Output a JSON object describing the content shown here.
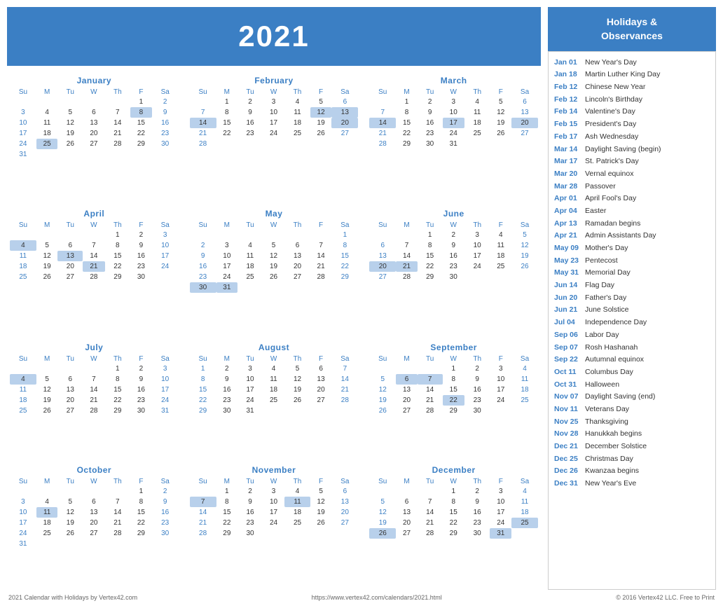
{
  "year": "2021",
  "footer": {
    "left": "2021 Calendar with Holidays by Vertex42.com",
    "center": "https://www.vertex42.com/calendars/2021.html",
    "right": "© 2016 Vertex42 LLC. Free to Print"
  },
  "sidebar": {
    "title": "Holidays &\nObservances",
    "holidays": [
      {
        "date": "Jan 01",
        "name": "New Year's Day"
      },
      {
        "date": "Jan 18",
        "name": "Martin Luther King Day"
      },
      {
        "date": "Feb 12",
        "name": "Chinese New Year"
      },
      {
        "date": "Feb 12",
        "name": "Lincoln's Birthday"
      },
      {
        "date": "Feb 14",
        "name": "Valentine's Day"
      },
      {
        "date": "Feb 15",
        "name": "President's Day"
      },
      {
        "date": "Feb 17",
        "name": "Ash Wednesday"
      },
      {
        "date": "Mar 14",
        "name": "Daylight Saving (begin)"
      },
      {
        "date": "Mar 17",
        "name": "St. Patrick's Day"
      },
      {
        "date": "Mar 20",
        "name": "Vernal equinox"
      },
      {
        "date": "Mar 28",
        "name": "Passover"
      },
      {
        "date": "Apr 01",
        "name": "April Fool's Day"
      },
      {
        "date": "Apr 04",
        "name": "Easter"
      },
      {
        "date": "Apr 13",
        "name": "Ramadan begins"
      },
      {
        "date": "Apr 21",
        "name": "Admin Assistants Day"
      },
      {
        "date": "May 09",
        "name": "Mother's Day"
      },
      {
        "date": "May 23",
        "name": "Pentecost"
      },
      {
        "date": "May 31",
        "name": "Memorial Day"
      },
      {
        "date": "Jun 14",
        "name": "Flag Day"
      },
      {
        "date": "Jun 20",
        "name": "Father's Day"
      },
      {
        "date": "Jun 21",
        "name": "June Solstice"
      },
      {
        "date": "Jul 04",
        "name": "Independence Day"
      },
      {
        "date": "Sep 06",
        "name": "Labor Day"
      },
      {
        "date": "Sep 07",
        "name": "Rosh Hashanah"
      },
      {
        "date": "Sep 22",
        "name": "Autumnal equinox"
      },
      {
        "date": "Oct 11",
        "name": "Columbus Day"
      },
      {
        "date": "Oct 31",
        "name": "Halloween"
      },
      {
        "date": "Nov 07",
        "name": "Daylight Saving (end)"
      },
      {
        "date": "Nov 11",
        "name": "Veterans Day"
      },
      {
        "date": "Nov 25",
        "name": "Thanksgiving"
      },
      {
        "date": "Nov 28",
        "name": "Hanukkah begins"
      },
      {
        "date": "Dec 21",
        "name": "December Solstice"
      },
      {
        "date": "Dec 25",
        "name": "Christmas Day"
      },
      {
        "date": "Dec 26",
        "name": "Kwanzaa begins"
      },
      {
        "date": "Dec 31",
        "name": "New Year's Eve"
      }
    ]
  },
  "months": [
    {
      "name": "January",
      "days": [
        [
          "",
          "",
          "",
          "",
          "",
          "1",
          "2"
        ],
        [
          "3",
          "4",
          "5",
          "6",
          "7",
          "8",
          "9"
        ],
        [
          "10",
          "11",
          "12",
          "13",
          "14",
          "15",
          "16"
        ],
        [
          "17",
          "18",
          "19",
          "20",
          "21",
          "22",
          "23"
        ],
        [
          "24",
          "25",
          "26",
          "27",
          "28",
          "29",
          "30"
        ],
        [
          "31",
          "",
          "",
          "",
          "",
          "",
          ""
        ]
      ],
      "highlights": {
        "1,5": "today",
        "1,6": "weekend",
        "2,6": "weekend",
        "3,0": "weekend",
        "3,6": "weekend",
        "4,0": "weekend",
        "4,6": "weekend",
        "5,0": "weekend",
        "5,6": "weekend",
        "6,0": "weekend",
        "1,1": "highlighted",
        "2,1": "",
        "3,1": ""
      },
      "weekend_cols": [
        0,
        6
      ],
      "blue_cells": [
        [
          1,
          5
        ],
        [
          1,
          6
        ],
        [
          2,
          0
        ],
        [
          2,
          6
        ],
        [
          3,
          0
        ],
        [
          3,
          6
        ],
        [
          4,
          0
        ],
        [
          4,
          6
        ],
        [
          5,
          0
        ],
        [
          5,
          6
        ],
        [
          6,
          0
        ]
      ],
      "special": {
        "r1c5": "today-highlight",
        "r4c1": "highlighted"
      }
    },
    {
      "name": "February",
      "days": [
        [
          "",
          "1",
          "2",
          "3",
          "4",
          "5",
          "6"
        ],
        [
          "7",
          "8",
          "9",
          "10",
          "11",
          "12",
          "13"
        ],
        [
          "14",
          "15",
          "16",
          "17",
          "18",
          "19",
          "20"
        ],
        [
          "21",
          "22",
          "23",
          "24",
          "25",
          "26",
          "27"
        ],
        [
          "28",
          "",
          "",
          "",
          "",
          "",
          ""
        ]
      ],
      "weekend_cols": [
        0,
        6
      ],
      "blue_cells": [
        [
          0,
          6
        ],
        [
          1,
          0
        ],
        [
          1,
          6
        ],
        [
          2,
          0
        ],
        [
          2,
          6
        ],
        [
          3,
          0
        ],
        [
          3,
          6
        ],
        [
          4,
          0
        ]
      ],
      "special": {
        "r1c5": "highlighted",
        "r1c6": "highlighted",
        "r2c0": "highlighted",
        "r2c6": "highlighted"
      }
    },
    {
      "name": "March",
      "days": [
        [
          "",
          "1",
          "2",
          "3",
          "4",
          "5",
          "6"
        ],
        [
          "7",
          "8",
          "9",
          "10",
          "11",
          "12",
          "13"
        ],
        [
          "14",
          "15",
          "16",
          "17",
          "18",
          "19",
          "20"
        ],
        [
          "21",
          "22",
          "23",
          "24",
          "25",
          "26",
          "27"
        ],
        [
          "28",
          "29",
          "30",
          "31",
          "",
          "",
          ""
        ]
      ],
      "weekend_cols": [
        0,
        6
      ],
      "blue_cells": [
        [
          0,
          6
        ],
        [
          1,
          0
        ],
        [
          1,
          6
        ],
        [
          2,
          0
        ],
        [
          2,
          6
        ],
        [
          3,
          0
        ],
        [
          3,
          6
        ],
        [
          4,
          0
        ]
      ],
      "special": {
        "r2c3": "highlighted",
        "r1c6": "highlighted",
        "r2c6": "highlighted"
      }
    },
    {
      "name": "April",
      "days": [
        [
          "",
          "",
          "",
          "",
          "1",
          "2",
          "3"
        ],
        [
          "4",
          "5",
          "6",
          "7",
          "8",
          "9",
          "10"
        ],
        [
          "11",
          "12",
          "13",
          "14",
          "15",
          "16",
          "17"
        ],
        [
          "18",
          "19",
          "20",
          "21",
          "22",
          "23",
          "24"
        ],
        [
          "25",
          "26",
          "27",
          "28",
          "29",
          "30",
          ""
        ]
      ],
      "weekend_cols": [
        0,
        6
      ],
      "blue_cells": [
        [
          0,
          5
        ],
        [
          0,
          6
        ],
        [
          1,
          0
        ],
        [
          1,
          6
        ],
        [
          2,
          0
        ],
        [
          2,
          6
        ],
        [
          3,
          0
        ],
        [
          3,
          6
        ],
        [
          4,
          0
        ]
      ],
      "special": {
        "r1c0": "highlighted",
        "r2c2": "highlighted",
        "r3c3": "highlighted"
      }
    },
    {
      "name": "May",
      "days": [
        [
          "",
          "",
          "",
          "",
          "",
          "",
          "1"
        ],
        [
          "2",
          "3",
          "4",
          "5",
          "6",
          "7",
          "8"
        ],
        [
          "9",
          "10",
          "11",
          "12",
          "13",
          "14",
          "15"
        ],
        [
          "16",
          "17",
          "18",
          "19",
          "20",
          "21",
          "22"
        ],
        [
          "23",
          "24",
          "25",
          "26",
          "27",
          "28",
          "29"
        ],
        [
          "30",
          "31",
          "",
          "",
          "",
          "",
          ""
        ]
      ],
      "weekend_cols": [
        0,
        6
      ],
      "blue_cells": [
        [
          0,
          6
        ],
        [
          1,
          0
        ],
        [
          1,
          6
        ],
        [
          2,
          0
        ],
        [
          2,
          6
        ],
        [
          3,
          0
        ],
        [
          3,
          6
        ],
        [
          4,
          0
        ],
        [
          4,
          6
        ],
        [
          5,
          0
        ]
      ],
      "special": {
        "r5c0": "highlighted",
        "r5c1": "highlighted"
      }
    },
    {
      "name": "June",
      "days": [
        [
          "",
          "",
          "1",
          "2",
          "3",
          "4",
          "5"
        ],
        [
          "6",
          "7",
          "8",
          "9",
          "10",
          "11",
          "12"
        ],
        [
          "13",
          "14",
          "15",
          "16",
          "17",
          "18",
          "19"
        ],
        [
          "20",
          "21",
          "22",
          "23",
          "24",
          "25",
          "26"
        ],
        [
          "27",
          "28",
          "29",
          "30",
          "",
          "",
          ""
        ]
      ],
      "weekend_cols": [
        0,
        6
      ],
      "blue_cells": [
        [
          0,
          5
        ],
        [
          0,
          6
        ],
        [
          1,
          0
        ],
        [
          1,
          6
        ],
        [
          2,
          0
        ],
        [
          2,
          6
        ],
        [
          3,
          0
        ],
        [
          3,
          6
        ],
        [
          4,
          0
        ]
      ],
      "special": {
        "r3c0": "highlighted",
        "r3c1": "highlighted"
      }
    },
    {
      "name": "July",
      "days": [
        [
          "",
          "",
          "",
          "",
          "1",
          "2",
          "3"
        ],
        [
          "4",
          "5",
          "6",
          "7",
          "8",
          "9",
          "10"
        ],
        [
          "11",
          "12",
          "13",
          "14",
          "15",
          "16",
          "17"
        ],
        [
          "18",
          "19",
          "20",
          "21",
          "22",
          "23",
          "24"
        ],
        [
          "25",
          "26",
          "27",
          "28",
          "29",
          "30",
          "31"
        ]
      ],
      "weekend_cols": [
        0,
        6
      ],
      "blue_cells": [
        [
          0,
          5
        ],
        [
          0,
          6
        ],
        [
          1,
          0
        ],
        [
          1,
          6
        ],
        [
          2,
          0
        ],
        [
          2,
          6
        ],
        [
          3,
          0
        ],
        [
          3,
          6
        ],
        [
          4,
          0
        ],
        [
          4,
          6
        ]
      ],
      "special": {
        "r1c0": "highlighted"
      }
    },
    {
      "name": "August",
      "days": [
        [
          "1",
          "2",
          "3",
          "4",
          "5",
          "6",
          "7"
        ],
        [
          "8",
          "9",
          "10",
          "11",
          "12",
          "13",
          "14"
        ],
        [
          "15",
          "16",
          "17",
          "18",
          "19",
          "20",
          "21"
        ],
        [
          "22",
          "23",
          "24",
          "25",
          "26",
          "27",
          "28"
        ],
        [
          "29",
          "30",
          "31",
          "",
          "",
          "",
          ""
        ]
      ],
      "weekend_cols": [
        0,
        6
      ],
      "blue_cells": [
        [
          0,
          0
        ],
        [
          0,
          6
        ],
        [
          1,
          0
        ],
        [
          1,
          6
        ],
        [
          2,
          0
        ],
        [
          2,
          6
        ],
        [
          3,
          0
        ],
        [
          3,
          6
        ],
        [
          4,
          0
        ]
      ],
      "special": {}
    },
    {
      "name": "September",
      "days": [
        [
          "",
          "",
          "",
          "1",
          "2",
          "3",
          "4"
        ],
        [
          "5",
          "6",
          "7",
          "8",
          "9",
          "10",
          "11"
        ],
        [
          "12",
          "13",
          "14",
          "15",
          "16",
          "17",
          "18"
        ],
        [
          "19",
          "20",
          "21",
          "22",
          "23",
          "24",
          "25"
        ],
        [
          "26",
          "27",
          "28",
          "29",
          "30",
          "",
          ""
        ]
      ],
      "weekend_cols": [
        0,
        6
      ],
      "blue_cells": [
        [
          0,
          4
        ],
        [
          0,
          6
        ],
        [
          1,
          0
        ],
        [
          1,
          6
        ],
        [
          2,
          0
        ],
        [
          2,
          6
        ],
        [
          3,
          0
        ],
        [
          3,
          6
        ],
        [
          4,
          0
        ]
      ],
      "special": {
        "r1c1": "highlighted",
        "r1c2": "highlighted",
        "r3c3": "highlighted"
      }
    },
    {
      "name": "October",
      "days": [
        [
          "",
          "",
          "",
          "",
          "",
          "1",
          "2"
        ],
        [
          "3",
          "4",
          "5",
          "6",
          "7",
          "8",
          "9"
        ],
        [
          "10",
          "11",
          "12",
          "13",
          "14",
          "15",
          "16"
        ],
        [
          "17",
          "18",
          "19",
          "20",
          "21",
          "22",
          "23"
        ],
        [
          "24",
          "25",
          "26",
          "27",
          "28",
          "29",
          "30"
        ],
        [
          "31",
          "",
          "",
          "",
          "",
          "",
          ""
        ]
      ],
      "weekend_cols": [
        0,
        6
      ],
      "blue_cells": [
        [
          0,
          6
        ],
        [
          1,
          0
        ],
        [
          1,
          6
        ],
        [
          2,
          0
        ],
        [
          2,
          6
        ],
        [
          3,
          0
        ],
        [
          3,
          6
        ],
        [
          4,
          0
        ],
        [
          4,
          6
        ],
        [
          5,
          0
        ]
      ],
      "special": {
        "r2c1": "highlighted"
      }
    },
    {
      "name": "November",
      "days": [
        [
          "",
          "1",
          "2",
          "3",
          "4",
          "5",
          "6"
        ],
        [
          "7",
          "8",
          "9",
          "10",
          "11",
          "12",
          "13"
        ],
        [
          "14",
          "15",
          "16",
          "17",
          "18",
          "19",
          "20"
        ],
        [
          "21",
          "22",
          "23",
          "24",
          "25",
          "26",
          "27"
        ],
        [
          "28",
          "29",
          "30",
          "",
          "",
          "",
          ""
        ]
      ],
      "weekend_cols": [
        0,
        6
      ],
      "blue_cells": [
        [
          0,
          6
        ],
        [
          1,
          0
        ],
        [
          1,
          6
        ],
        [
          2,
          0
        ],
        [
          2,
          6
        ],
        [
          3,
          0
        ],
        [
          3,
          6
        ],
        [
          4,
          0
        ]
      ],
      "special": {
        "r1c0": "highlighted",
        "r1c6": "highlighted"
      }
    },
    {
      "name": "December",
      "days": [
        [
          "",
          "",
          "",
          "1",
          "2",
          "3",
          "4"
        ],
        [
          "5",
          "6",
          "7",
          "8",
          "9",
          "10",
          "11"
        ],
        [
          "12",
          "13",
          "14",
          "15",
          "16",
          "17",
          "18"
        ],
        [
          "19",
          "20",
          "21",
          "22",
          "23",
          "24",
          "25"
        ],
        [
          "26",
          "27",
          "28",
          "29",
          "30",
          "31",
          ""
        ]
      ],
      "weekend_cols": [
        0,
        6
      ],
      "blue_cells": [
        [
          0,
          3
        ],
        [
          0,
          6
        ],
        [
          1,
          0
        ],
        [
          1,
          6
        ],
        [
          2,
          0
        ],
        [
          2,
          6
        ],
        [
          3,
          0
        ],
        [
          3,
          6
        ],
        [
          4,
          0
        ]
      ],
      "special": {
        "r3c6": "highlighted",
        "r4c0": "highlighted",
        "r4c5": "highlighted"
      }
    }
  ]
}
